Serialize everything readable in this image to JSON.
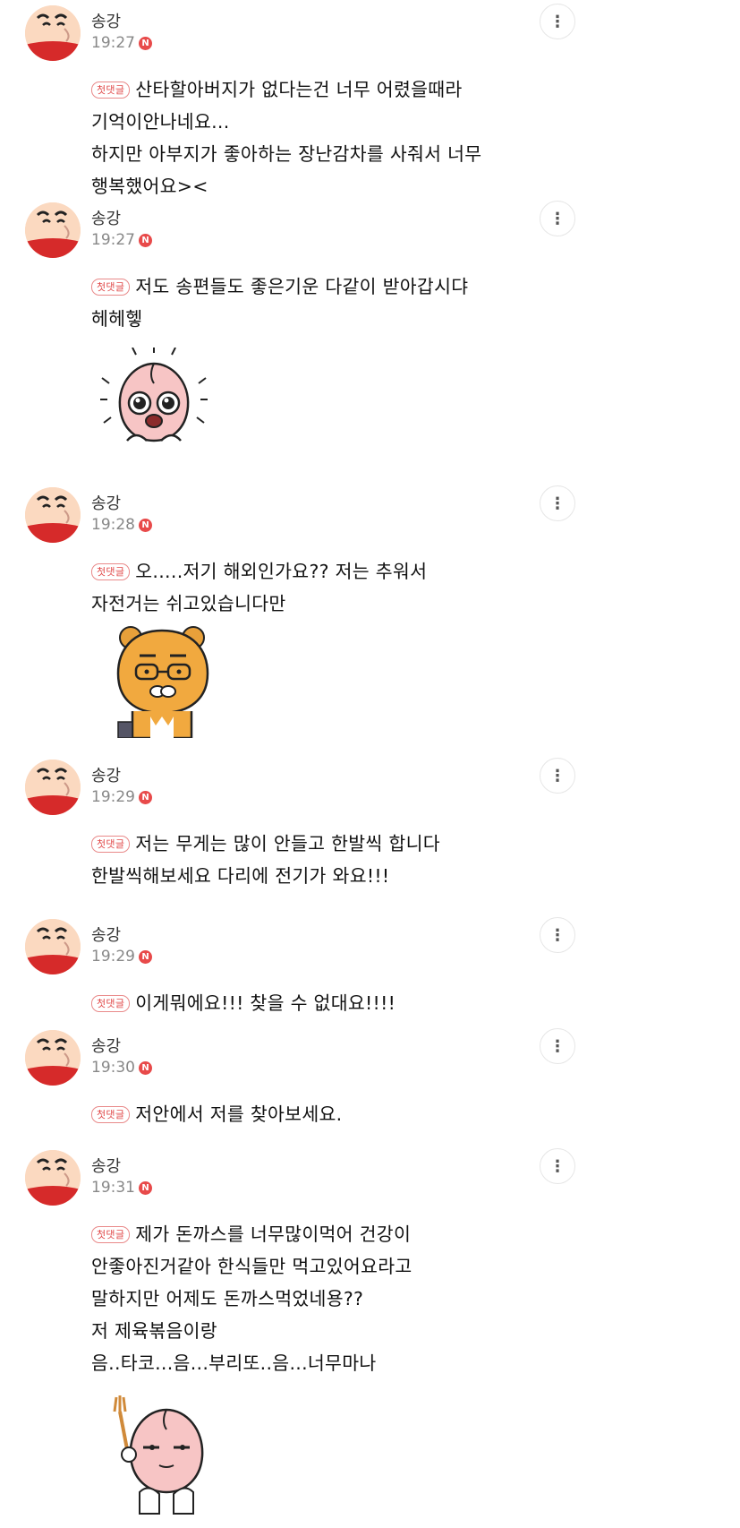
{
  "comments": [
    {
      "author": "송강",
      "time": "19:27",
      "badge": "첫댓글",
      "lines": [
        "산타할아버지가 없다는건 너무 어렸을때라",
        "기억이안나네요...",
        "하지만 아부지가 좋아하는 장난감차를 사줘서 너무",
        "행복했어요><"
      ]
    },
    {
      "author": "송강",
      "time": "19:27",
      "badge": "첫댓글",
      "lines": [
        "저도 송편들도 좋은기운 다같이 받아갑시댜",
        "헤헤헿"
      ],
      "sticker": "apeach-teary-sticker"
    },
    {
      "author": "송강",
      "time": "19:28",
      "badge": "첫댓글",
      "lines": [
        "오.....저기 해외인가요?? 저는 추워서",
        "자전거는 쉬고있습니다만"
      ],
      "sticker": "ryan-glasses-sticker"
    },
    {
      "author": "송강",
      "time": "19:29",
      "badge": "첫댓글",
      "lines": [
        "저는 무게는 많이 안들고 한발씩 합니다",
        "한발씩해보세요 다리에 전기가 와요!!!"
      ]
    },
    {
      "author": "송강",
      "time": "19:29",
      "badge": "첫댓글",
      "lines": [
        "이게뭐에요!!! 찾을 수 없대요!!!!"
      ]
    },
    {
      "author": "송강",
      "time": "19:30",
      "badge": "첫댓글",
      "lines": [
        "저안에서 저를 찾아보세요."
      ]
    },
    {
      "author": "송강",
      "time": "19:31",
      "badge": "첫댓글",
      "lines": [
        "제가 돈까스를 너무많이먹어 건강이",
        "안좋아진거같아 한식들만 먹고있어요라고",
        "말하지만 어제도 돈까스먹었네용??",
        "저 제육볶음이랑",
        "음..타코...음...부리또..음...너무마나"
      ],
      "sticker": "apeach-fork-sticker"
    }
  ],
  "new_badge_text": "N",
  "more_icon": "⋮",
  "colors": {
    "accent_red": "#e84a4a",
    "badge_border": "#e98a8a",
    "time_gray": "#888888"
  }
}
